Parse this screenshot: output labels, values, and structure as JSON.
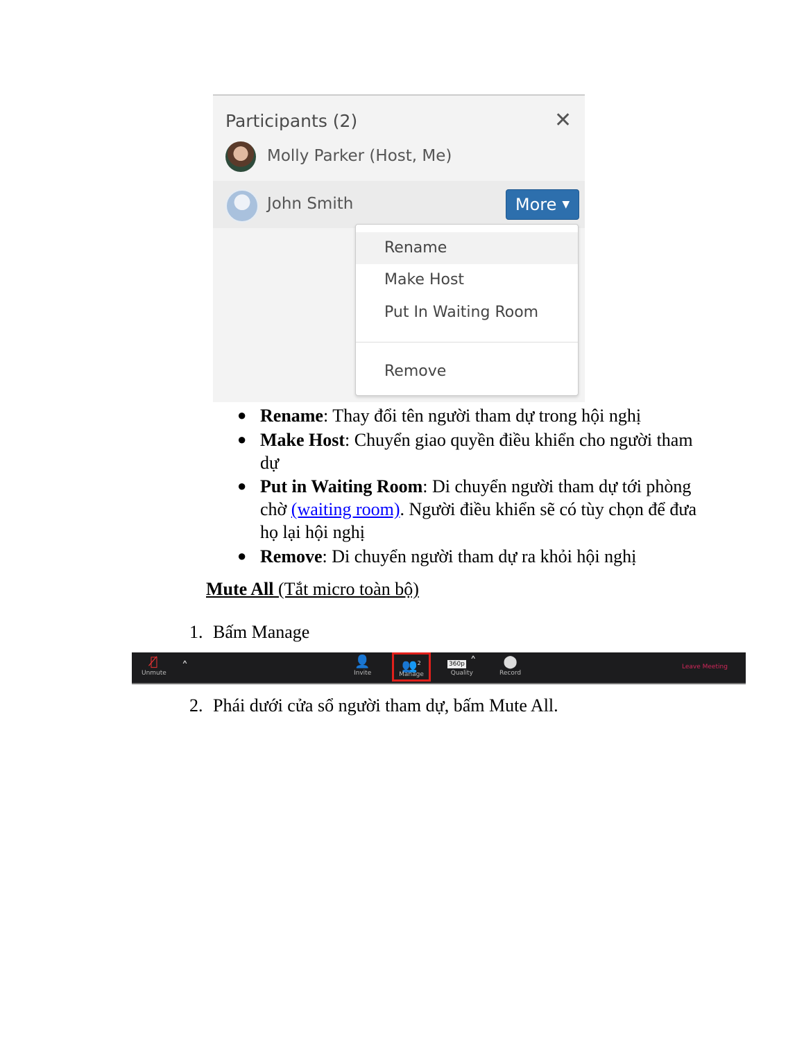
{
  "panel": {
    "title": "Participants (2)",
    "close_icon": "close-icon",
    "participants": [
      {
        "name": "Molly Parker (Host, Me)"
      },
      {
        "name": "John Smith"
      }
    ],
    "more_label": "More",
    "menu": [
      "Rename",
      "Make Host",
      "Put In Waiting Room",
      "Remove"
    ]
  },
  "bullets": [
    {
      "term": "Rename",
      "text": ": Thay đổi tên người tham dự trong hội nghị"
    },
    {
      "term": "Make Host",
      "text": ": Chuyển giao quyền điều khiển cho người tham",
      "text2": "dự"
    },
    {
      "term": "Put in Waiting Room",
      "text": ": Di chuyển người tham dự tới phòng",
      "pre": "chờ ",
      "link": "(waiting room)",
      "post": ". Người điều khiển sẽ có tùy chọn để đưa",
      "text3": "họ lại hội nghị"
    },
    {
      "term": "Remove",
      "text": ": Di chuyển người tham dự ra khỏi hội nghị"
    }
  ],
  "heading": {
    "bold": "Mute All",
    "rest": " (Tắt micro toàn bộ)"
  },
  "steps": [
    {
      "num": "1.",
      "text": "Bấm Manage"
    },
    {
      "num": "2.",
      "text": "Phái dưới cửa sổ người tham dự, bấm Mute All."
    }
  ],
  "toolbar": {
    "unmute": "Unmute",
    "invite": "Invite",
    "manage": "Manage",
    "manage_count": "2",
    "quality": "Quality",
    "quality_badge": "360p",
    "record": "Record",
    "leave": "Leave Meeting",
    "highlight_color": "#e0201b",
    "leave_color": "#d2275a"
  }
}
